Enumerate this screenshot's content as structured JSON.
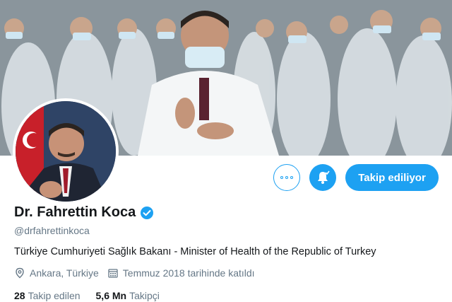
{
  "profile": {
    "name": "Dr. Fahrettin Koca",
    "handle": "@drfahrettinkoca",
    "bio": "Türkiye Cumhuriyeti Sağlık Bakanı - Minister of Health of the Republic of Turkey",
    "location": "Ankara, Türkiye",
    "joined": "Temmuz 2018 tarihinde katıldı",
    "verified": true
  },
  "stats": {
    "following_count": "28",
    "following_label": "Takip edilen",
    "followers_count": "5,6 Mn",
    "followers_label": "Takipçi"
  },
  "actions": {
    "more_icon": "more-options-icon",
    "notify_icon": "bell-notification-icon",
    "follow_label": "Takip ediliyor"
  },
  "colors": {
    "accent": "#1da1f2",
    "secondary_text": "#657786",
    "primary_text": "#14171a"
  }
}
